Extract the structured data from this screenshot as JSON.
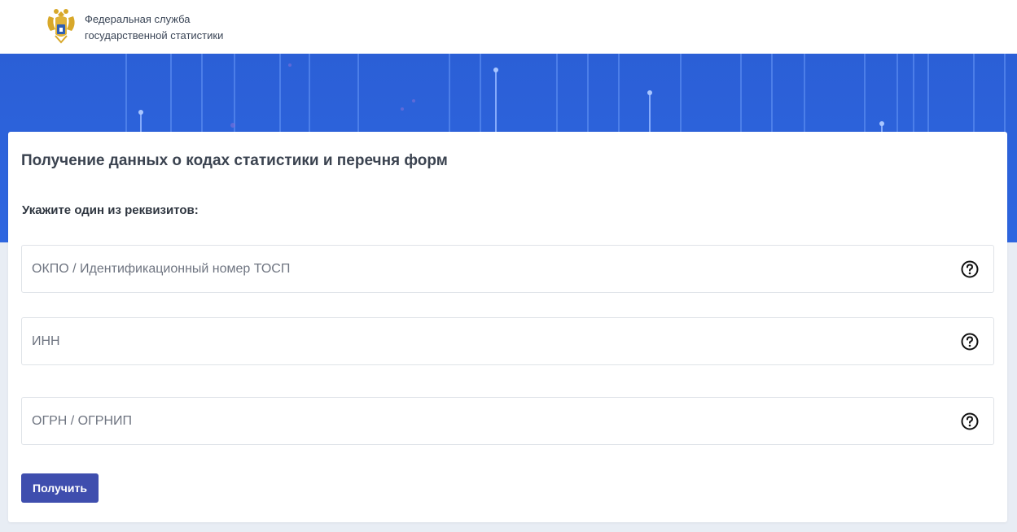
{
  "header": {
    "org_line1": "Федеральная служба",
    "org_line2": "государственной статистики",
    "logo_icon": "eagle-emblem-icon"
  },
  "form": {
    "title": "Получение данных о кодах статистики и перечня форм",
    "subtitle": "Укажите один из реквизитов:",
    "fields": [
      {
        "placeholder": "ОКПО / Идентификационный номер ТОСП",
        "value": "",
        "help_icon": "question-circle-icon"
      },
      {
        "placeholder": "ИНН",
        "value": "",
        "help_icon": "question-circle-icon"
      },
      {
        "placeholder": "ОГРН / ОГРНИП",
        "value": "",
        "help_icon": "question-circle-icon"
      }
    ],
    "submit_label": "Получить"
  },
  "colors": {
    "banner": "#2e66e0",
    "button": "#3f4eae",
    "page_bg": "#e8edf4"
  }
}
